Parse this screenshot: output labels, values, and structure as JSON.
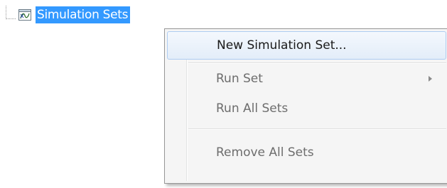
{
  "tree": {
    "node": {
      "label": "Simulation Sets",
      "icon": "simulation-set-icon",
      "selected": true,
      "selection_color": "#3399ff"
    }
  },
  "context_menu": {
    "items": [
      {
        "label": "New Simulation Set...",
        "enabled": true,
        "highlighted": true,
        "has_submenu": false
      },
      {
        "label": "Run Set",
        "enabled": false,
        "highlighted": false,
        "has_submenu": true
      },
      {
        "label": "Run All Sets",
        "enabled": false,
        "highlighted": false,
        "has_submenu": false
      },
      {
        "label": "Remove All Sets",
        "enabled": false,
        "highlighted": false,
        "has_submenu": false
      }
    ]
  },
  "colors": {
    "menu_background": "#f5f5f5",
    "menu_border": "#979797",
    "highlight_border": "#aeccf1",
    "disabled_text": "#6d6d6d",
    "enabled_text": "#1a1a1a"
  }
}
